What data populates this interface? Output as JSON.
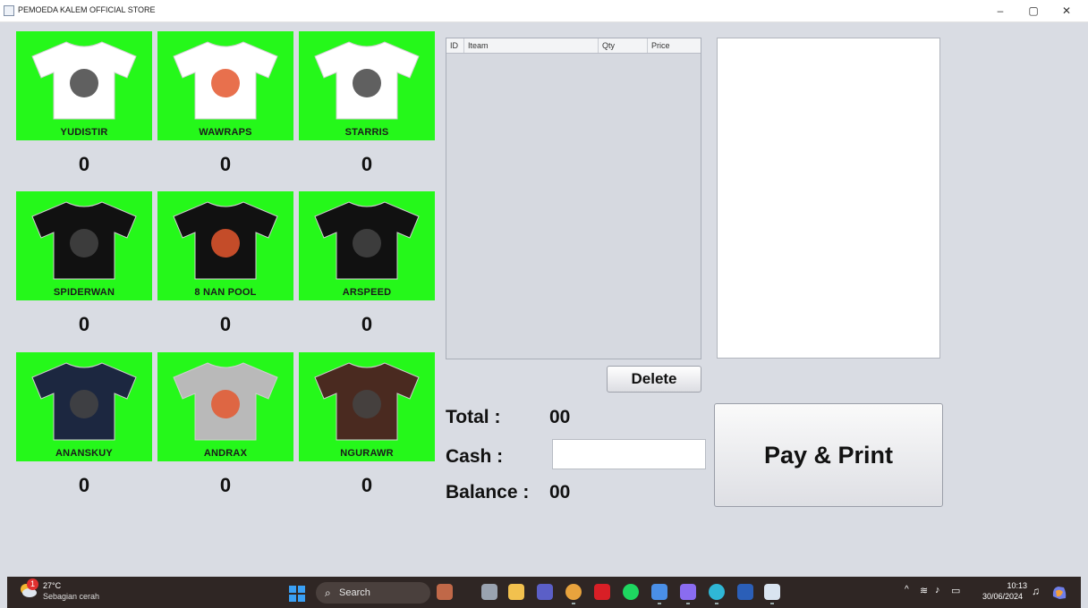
{
  "window": {
    "title": "PEMOEDA KALEM OFFICIAL STORE",
    "controls": {
      "minimize": "–",
      "restore": "▢",
      "close": "✕"
    }
  },
  "colors": {
    "product_bg": "#25f81a",
    "app_bg": "#d9dce3",
    "taskbar_bg": "#2f2624"
  },
  "products": [
    {
      "name": "YUDISTIR",
      "qty": "0",
      "shirt_color": "#ffffff",
      "icon": "tshirt-icon"
    },
    {
      "name": "WAWRAPS",
      "qty": "0",
      "shirt_color": "#ffffff",
      "icon": "tshirt-icon"
    },
    {
      "name": "STARRIS",
      "qty": "0",
      "shirt_color": "#ffffff",
      "icon": "tshirt-icon"
    },
    {
      "name": "SPIDERWAN",
      "qty": "0",
      "shirt_color": "#111111",
      "icon": "tshirt-icon"
    },
    {
      "name": "8 NAN POOL",
      "qty": "0",
      "shirt_color": "#111111",
      "icon": "tshirt-icon"
    },
    {
      "name": "ARSPEED",
      "qty": "0",
      "shirt_color": "#111111",
      "icon": "tshirt-icon"
    },
    {
      "name": "ANANSKUY",
      "qty": "0",
      "shirt_color": "#1c2740",
      "icon": "tshirt-icon"
    },
    {
      "name": "ANDRAX",
      "qty": "0",
      "shirt_color": "#b9b9b9",
      "icon": "tshirt-icon"
    },
    {
      "name": "NGURAWR",
      "qty": "0",
      "shirt_color": "#4a2a20",
      "icon": "tshirt-icon"
    }
  ],
  "order_table": {
    "columns": [
      "ID",
      "Iteam",
      "Qty",
      "Price"
    ],
    "rows": []
  },
  "delete_button": "Delete",
  "totals": {
    "total_label": "Total :",
    "total_value": "00",
    "cash_label": "Cash :",
    "cash_value": "",
    "balance_label": "Balance :",
    "balance_value": "00"
  },
  "pay_button": "Pay & Print",
  "taskbar": {
    "weather": {
      "badge": "1",
      "temp": "27°C",
      "desc": "Sebagian cerah"
    },
    "search": "Search",
    "apps": [
      {
        "name": "app-avatar-icon",
        "color": "#c06848"
      },
      {
        "name": "task-view-icon",
        "color": "#9aa3b0"
      },
      {
        "name": "file-explorer-icon",
        "color": "#f2c14e"
      },
      {
        "name": "teams-icon",
        "color": "#5b5fc7"
      },
      {
        "name": "chrome-icon",
        "color": "#e8a33d"
      },
      {
        "name": "netflix-icon",
        "color": "#d81f26"
      },
      {
        "name": "spotify-icon",
        "color": "#1ed760"
      },
      {
        "name": "chrome-alt-icon",
        "color": "#4a8fe7"
      },
      {
        "name": "shield-app-icon",
        "color": "#8a6cf0"
      },
      {
        "name": "edge-icon",
        "color": "#2fb7d6"
      },
      {
        "name": "word-icon",
        "color": "#2b5fb8"
      },
      {
        "name": "java-icon",
        "color": "#d9e4f0"
      }
    ],
    "tray": {
      "chevron": "^",
      "wifi": "≋",
      "volume": "♪",
      "battery": "▭",
      "time": "10:13",
      "date": "30/06/2024",
      "bell": "♫"
    }
  }
}
